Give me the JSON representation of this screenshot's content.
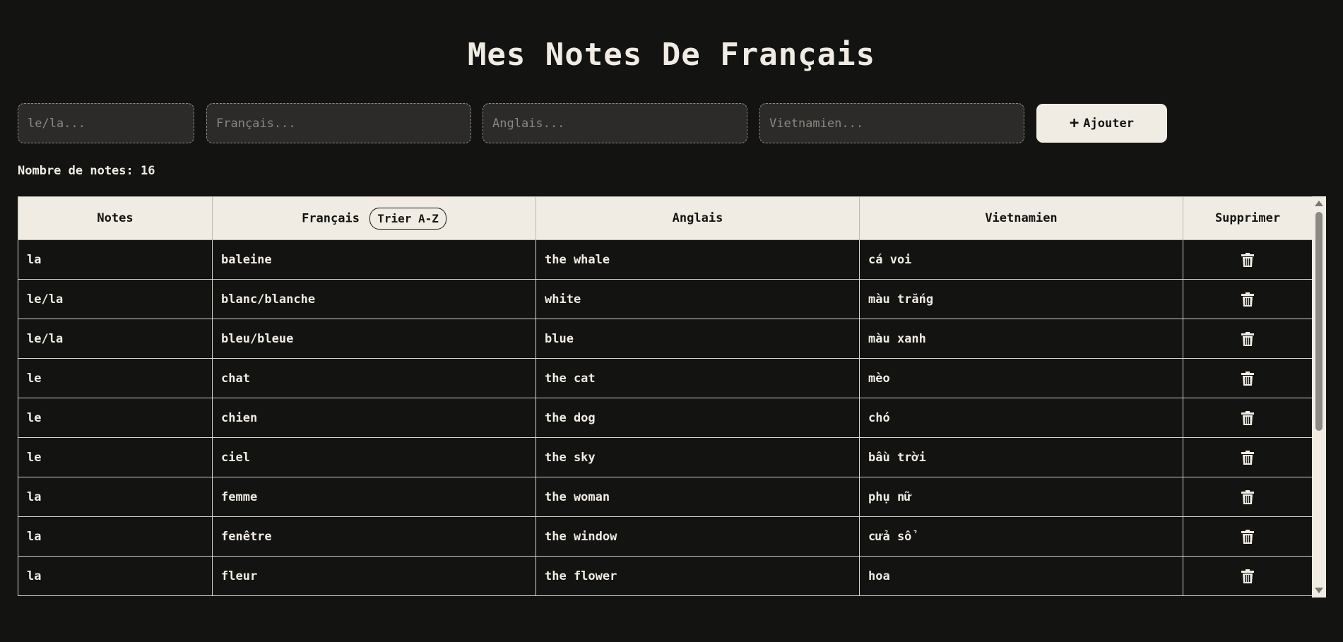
{
  "title": "Mes Notes De Français",
  "form": {
    "article_placeholder": "le/la...",
    "french_placeholder": "Français...",
    "english_placeholder": "Anglais...",
    "vietnamese_placeholder": "Vietnamien...",
    "add_label": "Ajouter",
    "add_icon": "plus-icon"
  },
  "count_text": "Nombre de notes: 16",
  "table": {
    "headers": {
      "notes": "Notes",
      "french": "Français",
      "sort_label": "Trier A-Z",
      "english": "Anglais",
      "vietnamese": "Vietnamien",
      "delete": "Supprimer"
    },
    "delete_icon": "trash-icon",
    "rows": [
      {
        "note": "la",
        "french": "baleine",
        "english": "the whale",
        "vietnamese": "cá voi"
      },
      {
        "note": "le/la",
        "french": "blanc/blanche",
        "english": "white",
        "vietnamese": "màu trắng"
      },
      {
        "note": "le/la",
        "french": "bleu/bleue",
        "english": "blue",
        "vietnamese": "màu xanh"
      },
      {
        "note": "le",
        "french": "chat",
        "english": "the cat",
        "vietnamese": "mèo"
      },
      {
        "note": "le",
        "french": "chien",
        "english": "the dog",
        "vietnamese": "chó"
      },
      {
        "note": "le",
        "french": "ciel",
        "english": "the sky",
        "vietnamese": "bầu trời"
      },
      {
        "note": "la",
        "french": "femme",
        "english": "the woman",
        "vietnamese": "phụ nữ"
      },
      {
        "note": "la",
        "french": "fenêtre",
        "english": "the window",
        "vietnamese": "cửa sổ"
      },
      {
        "note": "la",
        "french": "fleur",
        "english": "the flower",
        "vietnamese": "hoa"
      }
    ]
  },
  "colors": {
    "background": "#131311",
    "cream": "#f0ece3",
    "input_bg": "#2c2b29"
  }
}
